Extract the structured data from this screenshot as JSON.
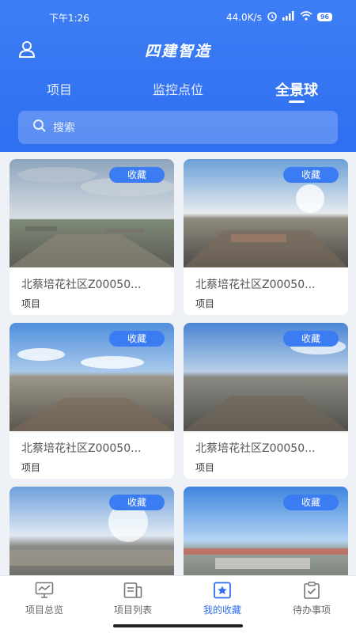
{
  "status": {
    "time": "下午1:26",
    "speed": "44.0K/s",
    "battery": "96"
  },
  "header": {
    "title": "四建智造"
  },
  "tabs": [
    {
      "label": "项目",
      "active": false
    },
    {
      "label": "监控点位",
      "active": false
    },
    {
      "label": "全景球",
      "active": true
    }
  ],
  "search": {
    "placeholder": "搜索"
  },
  "cards": [
    {
      "title": "北蔡培花社区Z00050...",
      "subtitle": "项目",
      "badge": "收藏"
    },
    {
      "title": "北蔡培花社区Z00050...",
      "subtitle": "项目",
      "badge": "收藏"
    },
    {
      "title": "北蔡培花社区Z00050...",
      "subtitle": "项目",
      "badge": "收藏"
    },
    {
      "title": "北蔡培花社区Z00050...",
      "subtitle": "项目",
      "badge": "收藏"
    },
    {
      "title": "",
      "subtitle": "",
      "badge": "收藏"
    },
    {
      "title": "",
      "subtitle": "",
      "badge": "收藏"
    }
  ],
  "nav": [
    {
      "label": "项目总览",
      "icon": "monitor-chart-icon",
      "active": false
    },
    {
      "label": "项目列表",
      "icon": "list-icon",
      "active": false
    },
    {
      "label": "我的收藏",
      "icon": "star-icon",
      "active": true
    },
    {
      "label": "待办事项",
      "icon": "clipboard-check-icon",
      "active": false
    }
  ],
  "colors": {
    "primary": "#2f6ff0",
    "badge": "#3b7cf2"
  }
}
